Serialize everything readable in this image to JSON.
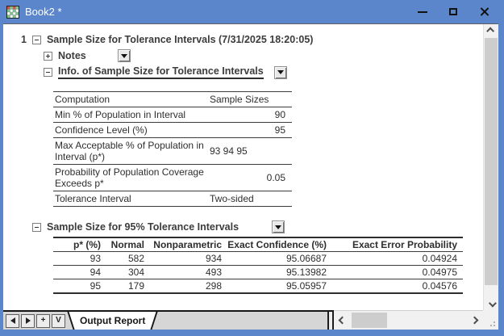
{
  "window": {
    "title": "Book2 *"
  },
  "report": {
    "index": "1",
    "title": "Sample Size for Tolerance Intervals (7/31/2025 18:20:05)",
    "notes_label": "Notes",
    "info_section": {
      "title": "Info. of Sample Size for Tolerance Intervals",
      "table": {
        "rows": [
          {
            "label": "Computation",
            "value": "Sample Sizes"
          },
          {
            "label": "Min % of Population in Interval",
            "value": "90"
          },
          {
            "label": "Confidence Level (%)",
            "value": "95"
          },
          {
            "label": "Max Acceptable % of Population in Interval (p*)",
            "value": "93 94 95"
          },
          {
            "label": "Probability of Population Coverage Exceeds p*",
            "value": "0.05"
          },
          {
            "label": "Tolerance Interval",
            "value": "Two-sided"
          }
        ]
      }
    },
    "result_section": {
      "title": "Sample Size for 95% Tolerance Intervals",
      "table": {
        "headers": [
          "p* (%)",
          "Normal",
          "Nonparametric",
          "Exact Confidence (%)",
          "Exact Error Probability"
        ],
        "rows": [
          [
            "93",
            "582",
            "934",
            "95.06687",
            "0.04924"
          ],
          [
            "94",
            "304",
            "493",
            "95.13982",
            "0.04975"
          ],
          [
            "95",
            "179",
            "298",
            "95.05957",
            "0.04576"
          ]
        ]
      }
    }
  },
  "tabbar": {
    "tab_label": "Output Report",
    "nav_plus_label": "+",
    "nav_list_label": "V"
  },
  "colors": {
    "titlebar_blue": "#5b86cb",
    "border_blue": "#5b86cb",
    "table_border": "#3d3d3d",
    "tabstrip_gray": "#d6d6d6",
    "scrollbar_thumb": "#cdcdcd",
    "scrollbar_track": "#f1f1f1"
  }
}
